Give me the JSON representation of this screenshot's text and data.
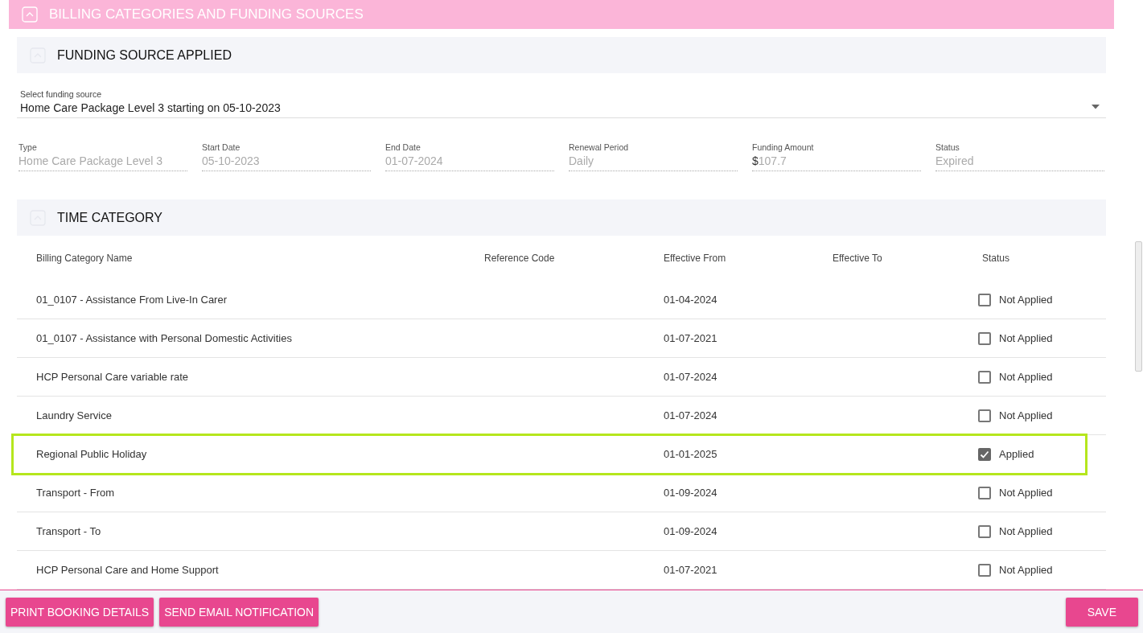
{
  "page_header": {
    "title": "BILLING CATEGORIES AND FUNDING SOURCES",
    "expanded": true
  },
  "funding_section": {
    "title": "FUNDING SOURCE APPLIED",
    "expanded": true,
    "select": {
      "label": "Select funding source",
      "value": "Home Care Package Level 3 starting on 05-10-2023"
    },
    "fields": [
      {
        "label": "Type",
        "value": "Home Care Package Level 3"
      },
      {
        "label": "Start Date",
        "value": "05-10-2023"
      },
      {
        "label": "End Date",
        "value": "01-07-2024"
      },
      {
        "label": "Renewal Period",
        "value": "Daily"
      },
      {
        "label": "Funding Amount",
        "prefix": "$",
        "value": "107.7"
      },
      {
        "label": "Status",
        "value": "Expired"
      }
    ]
  },
  "time_section": {
    "title": "TIME CATEGORY",
    "expanded": true,
    "table": {
      "columns": [
        "Billing Category Name",
        "Reference Code",
        "Effective From",
        "Effective To",
        "Status"
      ],
      "rows": [
        {
          "name": "01_0107 - Assistance From Live-In Carer",
          "effective_from": "01-04-2024",
          "checked": false,
          "status": "Not Applied",
          "highlighted": false
        },
        {
          "name": "01_0107 - Assistance with Personal Domestic Activities",
          "effective_from": "01-07-2021",
          "checked": false,
          "status": "Not Applied",
          "highlighted": false
        },
        {
          "name": "HCP Personal Care variable rate",
          "effective_from": "01-07-2024",
          "checked": false,
          "status": "Not Applied",
          "highlighted": false
        },
        {
          "name": "Laundry Service",
          "effective_from": "01-07-2024",
          "checked": false,
          "status": "Not Applied",
          "highlighted": false
        },
        {
          "name": "Regional Public Holiday",
          "effective_from": "01-01-2025",
          "checked": true,
          "status": "Applied",
          "highlighted": true
        },
        {
          "name": "Transport - From",
          "effective_from": "01-09-2024",
          "checked": false,
          "status": "Not Applied",
          "highlighted": false
        },
        {
          "name": "Transport - To",
          "effective_from": "01-09-2024",
          "checked": false,
          "status": "Not Applied",
          "highlighted": false
        },
        {
          "name": "HCP Personal Care and Home Support",
          "effective_from": "01-07-2021",
          "checked": false,
          "status": "Not Applied",
          "highlighted": false
        }
      ]
    }
  },
  "footer": {
    "buttons": [
      "PRINT BOOKING DETAILS",
      "SEND EMAIL NOTIFICATION"
    ],
    "save_button": "SAVE"
  }
}
